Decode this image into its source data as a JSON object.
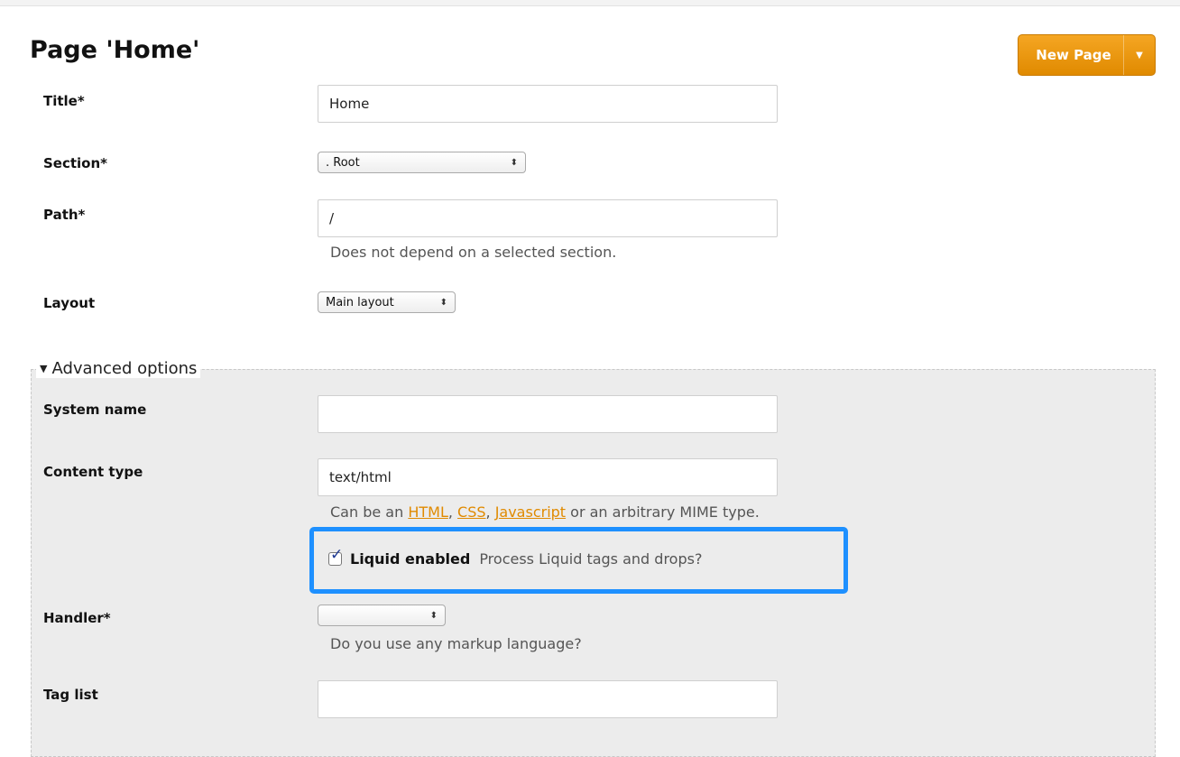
{
  "page": {
    "title": "Page 'Home'"
  },
  "header": {
    "new_page_label": "New Page"
  },
  "form": {
    "title": {
      "label": "Title*",
      "value": "Home"
    },
    "section": {
      "label": "Section*",
      "value": ". Root"
    },
    "path": {
      "label": "Path*",
      "value": "/",
      "hint": "Does not depend on a selected section."
    },
    "layout": {
      "label": "Layout",
      "value": "Main layout"
    }
  },
  "advanced": {
    "legend": "Advanced options",
    "system_name": {
      "label": "System name",
      "value": ""
    },
    "content_type": {
      "label": "Content type",
      "value": "text/html",
      "hint_prefix": "Can be an ",
      "link_html": "HTML",
      "sep1": ", ",
      "link_css": "CSS",
      "sep2": ", ",
      "link_js": "Javascript",
      "hint_suffix": " or an arbitrary MIME type."
    },
    "liquid": {
      "label": "Liquid enabled",
      "hint": "Process Liquid tags and drops?",
      "checked": true
    },
    "handler": {
      "label": "Handler*",
      "value": "",
      "hint": "Do you use any markup language?"
    },
    "tag_list": {
      "label": "Tag list",
      "value": ""
    }
  },
  "colors": {
    "accent": "#e08a00",
    "highlight": "#1e90ff",
    "panel": "#ececec"
  },
  "icons": {
    "dropdown": "caret-down-icon",
    "select": "updown-arrows-icon",
    "toggle": "triangle-down-icon",
    "checkbox": "check-icon"
  }
}
